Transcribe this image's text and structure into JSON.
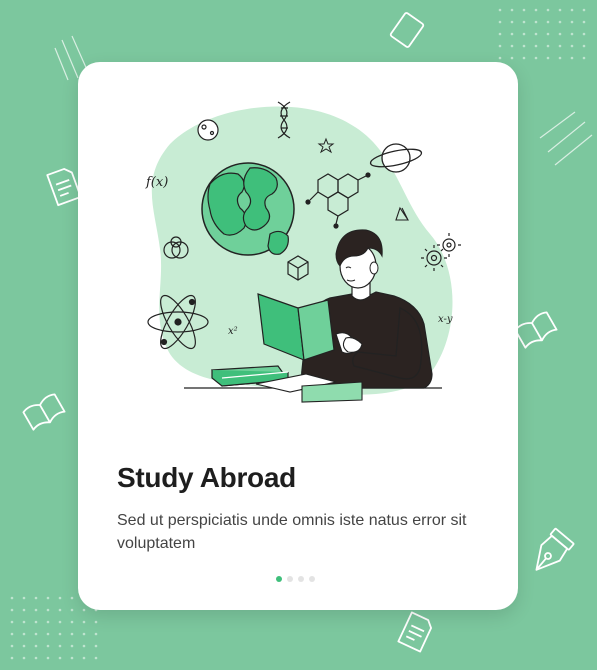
{
  "onboarding": {
    "title": "Study Abroad",
    "description": "Sed ut perspiciatis unde omnis iste natus error sit voluptatem",
    "pagination": {
      "total": 4,
      "active": 1
    }
  },
  "illustration": {
    "formula_fx": "f(x)",
    "formula_x2": "x²",
    "formula_xy": "x-y"
  },
  "icons": [
    "book-icon",
    "document-icon",
    "pen-nib-icon",
    "atom-icon",
    "planet-icon",
    "globe-icon",
    "dna-icon",
    "molecule-icon",
    "gear-icon",
    "cube-icon"
  ],
  "colors": {
    "background": "#7cc79e",
    "card": "#ffffff",
    "blob": "#c8ecd4",
    "accent": "#3fbf7b",
    "dot_active": "#3fbf7b",
    "dot_inactive": "#e3e3e3",
    "title": "#1e1e1e",
    "text": "#444444"
  }
}
